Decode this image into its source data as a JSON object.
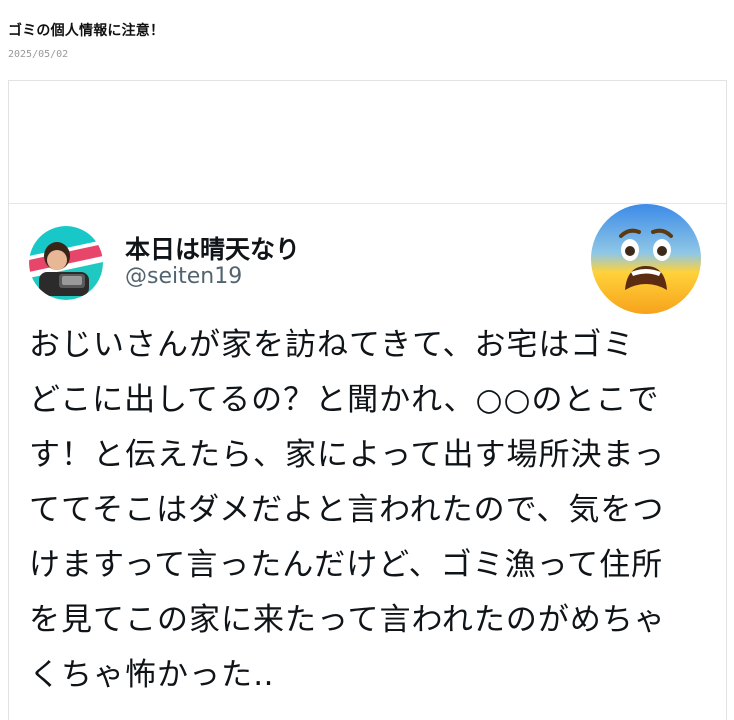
{
  "article": {
    "title": "ゴミの個人情報に注意！",
    "date": "2025/05/02"
  },
  "tweet": {
    "display_name": "本日は晴天なり",
    "handle": "@seiten19",
    "text": "おじいさんが家を訪ねてきて、お宅はゴミ\nどこに出してるの？と聞かれ、○○のとこで\nす！と伝えたら、家によって出す場所決まっ\nててそこはダメだよと言われたので、気をつ\nけますって言ったんだけど、ゴミ漁って住所\nを見てこの家に来たって言われたのがめちゃ\nくちゃ怖かった‥",
    "emoji": "fearful-face-emoji"
  },
  "colors": {
    "name": "#0f1419",
    "handle": "#536471",
    "border": "#e2e2e2",
    "date": "#999999",
    "avatar_ring": "#18c8c8",
    "avatar_accent": "#e8456b"
  }
}
